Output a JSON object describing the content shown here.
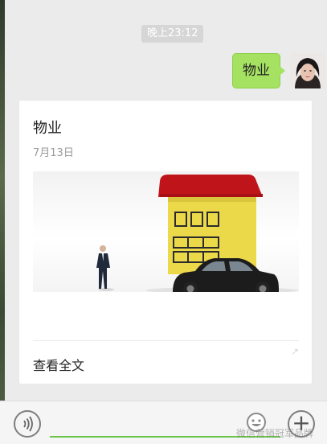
{
  "chat": {
    "timestamp": "晚上23:12",
    "sent_message": "物业"
  },
  "card": {
    "title": "物业",
    "date": "7月13日",
    "read_more": "查看全文"
  },
  "bottom_bar": {
    "voice_icon": "voice-icon",
    "emoji_icon": "emoji-icon",
    "plus_icon": "plus-icon",
    "plus_glyph": "+"
  },
  "watermark": "微信营销冠军品牌",
  "colors": {
    "bubble": "#a5e262",
    "accent_line": "#69c64a",
    "roof": "#c0141b",
    "house": "#ecd94a"
  }
}
